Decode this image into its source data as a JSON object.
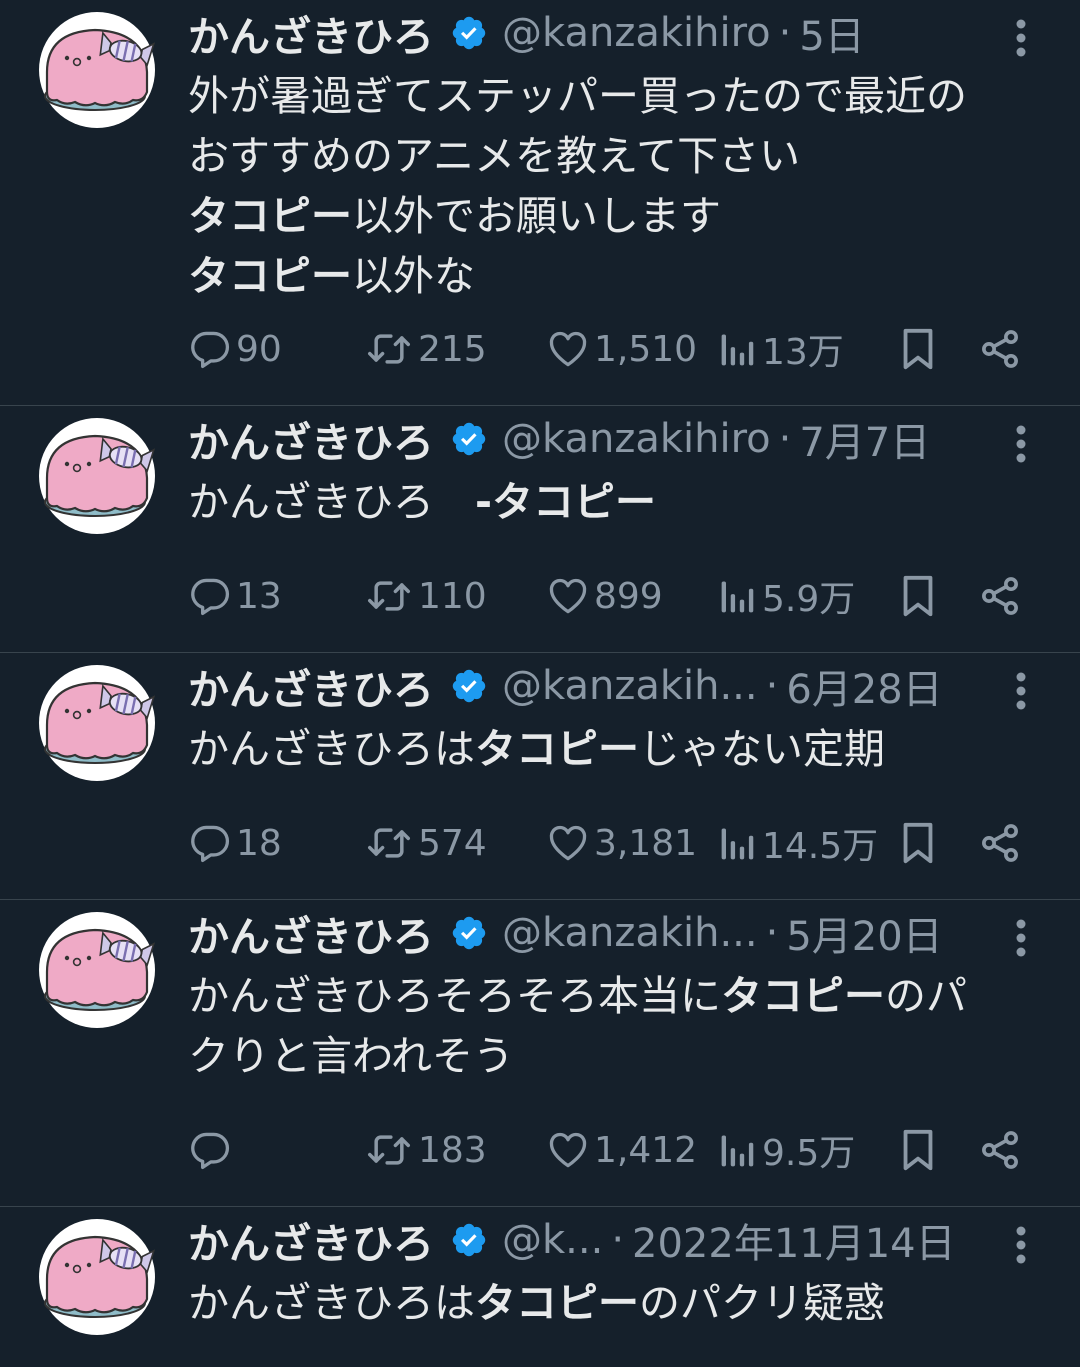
{
  "tweets": [
    {
      "name": "かんざきひろ",
      "handle": "@kanzakihiro",
      "date": "5日",
      "lines": [
        [
          {
            "t": "外が暑過ぎてステッパー買ったので最近の",
            "b": false
          }
        ],
        [
          {
            "t": "おすすめのアニメを教えて下さい",
            "b": false
          }
        ],
        [
          {
            "t": "タコピー",
            "b": true
          },
          {
            "t": "以外でお願いします",
            "b": false
          }
        ],
        [
          {
            "t": "タコピー",
            "b": true
          },
          {
            "t": "以外な",
            "b": false
          }
        ]
      ],
      "replies": "90",
      "retweets": "215",
      "likes": "1,510",
      "views": "13万"
    },
    {
      "name": "かんざきひろ",
      "handle": "@kanzakihiro",
      "date": "7月7日",
      "lines": [
        [
          {
            "t": "かんざきひろ　",
            "b": false
          },
          {
            "t": "-タコピー",
            "b": true
          }
        ]
      ],
      "replies": "13",
      "retweets": "110",
      "likes": "899",
      "views": "5.9万"
    },
    {
      "name": "かんざきひろ",
      "handle": "@kanzakih...",
      "date": "6月28日",
      "lines": [
        [
          {
            "t": "かんざきひろは",
            "b": false
          },
          {
            "t": "タコピー",
            "b": true
          },
          {
            "t": "じゃない定期",
            "b": false
          }
        ]
      ],
      "replies": "18",
      "retweets": "574",
      "likes": "3,181",
      "views": "14.5万"
    },
    {
      "name": "かんざきひろ",
      "handle": "@kanzakih...",
      "date": "5月20日",
      "lines": [
        [
          {
            "t": "かんざきひろそろそろ本当に",
            "b": false
          },
          {
            "t": "タコピー",
            "b": true
          },
          {
            "t": "のパ",
            "b": false
          }
        ],
        [
          {
            "t": "クりと言われそう",
            "b": false
          }
        ]
      ],
      "replies": "",
      "retweets": "183",
      "likes": "1,412",
      "views": "9.5万"
    },
    {
      "name": "かんざきひろ",
      "handle": "@k...",
      "date": "2022年11月14日",
      "lines": [
        [
          {
            "t": "かんざきひろは",
            "b": false
          },
          {
            "t": "タコピー",
            "b": true
          },
          {
            "t": "のパクリ疑惑",
            "b": false
          }
        ]
      ],
      "replies": "",
      "retweets": "",
      "likes": "",
      "views": ""
    }
  ],
  "icons": {
    "verified": "verified-badge-icon",
    "more": "more-options-icon",
    "reply": "reply-icon",
    "retweet": "retweet-icon",
    "like": "heart-icon",
    "views": "views-chart-icon",
    "bookmark": "bookmark-icon",
    "share": "share-icon"
  },
  "colors": {
    "background": "#15202b",
    "text": "#e7e9ea",
    "muted": "#8b98a5",
    "verified": "#1d9bf0",
    "divider": "#38444d"
  }
}
